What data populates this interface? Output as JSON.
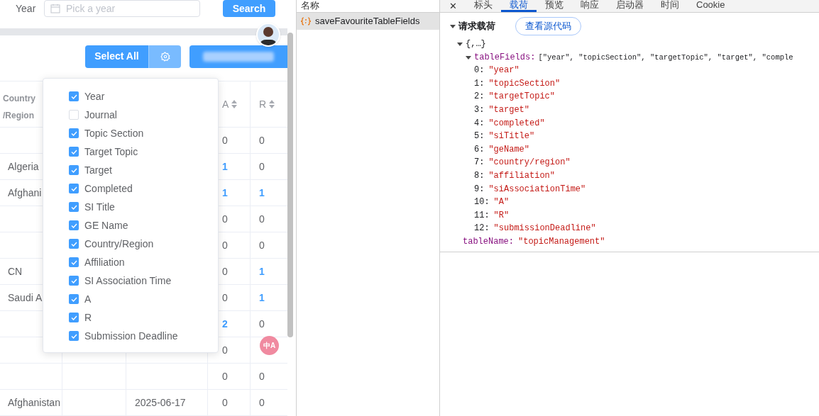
{
  "filter": {
    "label": "Year",
    "placeholder": "Pick a year",
    "button": "Search"
  },
  "toolbar": {
    "select_all": "Select All"
  },
  "column_popover": {
    "items": [
      {
        "label": "Year",
        "checked": true
      },
      {
        "label": "Journal",
        "checked": false
      },
      {
        "label": "Topic Section",
        "checked": true
      },
      {
        "label": "Target Topic",
        "checked": true
      },
      {
        "label": "Target",
        "checked": true
      },
      {
        "label": "Completed",
        "checked": true
      },
      {
        "label": "SI Title",
        "checked": true
      },
      {
        "label": "GE Name",
        "checked": true
      },
      {
        "label": "Country/Region",
        "checked": true
      },
      {
        "label": "Affiliation",
        "checked": true
      },
      {
        "label": "SI Association Time",
        "checked": true
      },
      {
        "label": "A",
        "checked": true
      },
      {
        "label": "R",
        "checked": true
      },
      {
        "label": "Submission Deadline",
        "checked": true
      }
    ]
  },
  "table": {
    "country_header": "Country /Region",
    "a_header": "A",
    "r_header": "R",
    "rows": [
      {
        "a": {
          "text": "0",
          "link": false
        },
        "r": {
          "text": "0",
          "link": false
        }
      },
      {
        "country": "Algeria",
        "a": {
          "text": "1",
          "link": true
        },
        "r": {
          "text": "0",
          "link": false
        }
      },
      {
        "country": "Afghani",
        "a": {
          "text": "1",
          "link": true
        },
        "r": {
          "text": "1",
          "link": true
        }
      },
      {
        "a": {
          "text": "0",
          "link": false
        },
        "r": {
          "text": "0",
          "link": false
        }
      },
      {
        "a": {
          "text": "0",
          "link": false
        },
        "r": {
          "text": "0",
          "link": false
        }
      },
      {
        "country": "CN",
        "a": {
          "text": "0",
          "link": false
        },
        "r": {
          "text": "1",
          "link": true
        }
      },
      {
        "country": "Saudi A",
        "a": {
          "text": "0",
          "link": false
        },
        "r": {
          "text": "1",
          "link": true
        }
      },
      {
        "a": {
          "text": "2",
          "link": true
        },
        "r": {
          "text": "0",
          "link": false
        }
      },
      {
        "a": {
          "text": "0",
          "link": false
        }
      },
      {
        "a": {
          "text": "0",
          "link": false
        },
        "r": {
          "text": "0",
          "link": false
        }
      },
      {
        "country": "Afghanistan",
        "date": "2025-06-17",
        "a": {
          "text": "0",
          "link": false
        },
        "r": {
          "text": "0",
          "link": false
        }
      }
    ]
  },
  "translate_button": "中A",
  "devtools": {
    "name_header": "名称",
    "requests": [
      {
        "name": "saveFavouriteTableFields",
        "selected": true
      }
    ],
    "close": "✕",
    "tabs": [
      {
        "label": "标头",
        "selected": false
      },
      {
        "label": "载荷",
        "selected": true
      },
      {
        "label": "预览",
        "selected": false
      },
      {
        "label": "响应",
        "selected": false
      },
      {
        "label": "启动器",
        "selected": false
      },
      {
        "label": "时间",
        "selected": false
      },
      {
        "label": "Cookie",
        "selected": false
      }
    ],
    "section": {
      "title": "请求载荷",
      "expanded": true
    },
    "view_source": "查看源代码",
    "root": {
      "text": "{,…}",
      "expanded": true
    },
    "fields_key": "tableFields:",
    "fields_expanded": true,
    "fields_preview": "[\"year\", \"topicSection\", \"targetTopic\", \"target\", \"comple",
    "fields": [
      {
        "index": "0:",
        "value": "\"year\""
      },
      {
        "index": "1:",
        "value": "\"topicSection\""
      },
      {
        "index": "2:",
        "value": "\"targetTopic\""
      },
      {
        "index": "3:",
        "value": "\"target\""
      },
      {
        "index": "4:",
        "value": "\"completed\""
      },
      {
        "index": "5:",
        "value": "\"siTitle\""
      },
      {
        "index": "6:",
        "value": "\"geName\""
      },
      {
        "index": "7:",
        "value": "\"country/region\""
      },
      {
        "index": "8:",
        "value": "\"affiliation\""
      },
      {
        "index": "9:",
        "value": "\"siAssociationTime\""
      },
      {
        "index": "10:",
        "value": "\"A\""
      },
      {
        "index": "11:",
        "value": "\"R\""
      },
      {
        "index": "12:",
        "value": "\"submissionDeadline\""
      }
    ],
    "table_name_key": "tableName:",
    "table_name": "\"topicManagement\""
  }
}
